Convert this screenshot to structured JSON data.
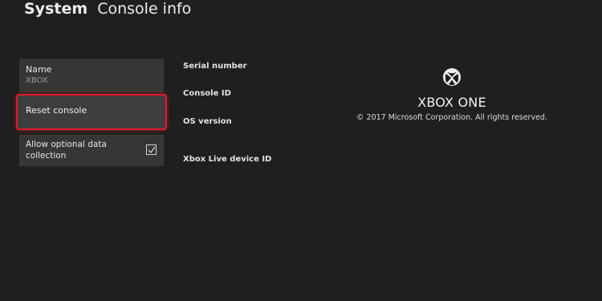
{
  "header": {
    "section": "System",
    "page": "Console info"
  },
  "settings": {
    "name": {
      "label": "Name",
      "value": "XBOX"
    },
    "reset": {
      "label": "Reset console"
    },
    "optional_data": {
      "label": "Allow optional data collection",
      "checked": true
    }
  },
  "info": {
    "serial_label": "Serial number",
    "console_id_label": "Console ID",
    "os_version_label": "OS version",
    "live_device_label": "Xbox Live device ID"
  },
  "brand": {
    "logo_icon": "xbox-logo-icon",
    "model": "XBOX ONE",
    "copyright": "© 2017 Microsoft Corporation. All rights reserved."
  },
  "colors": {
    "background": "#1f1f1f",
    "tile": "#363636",
    "focus_border": "#e01b2a"
  }
}
